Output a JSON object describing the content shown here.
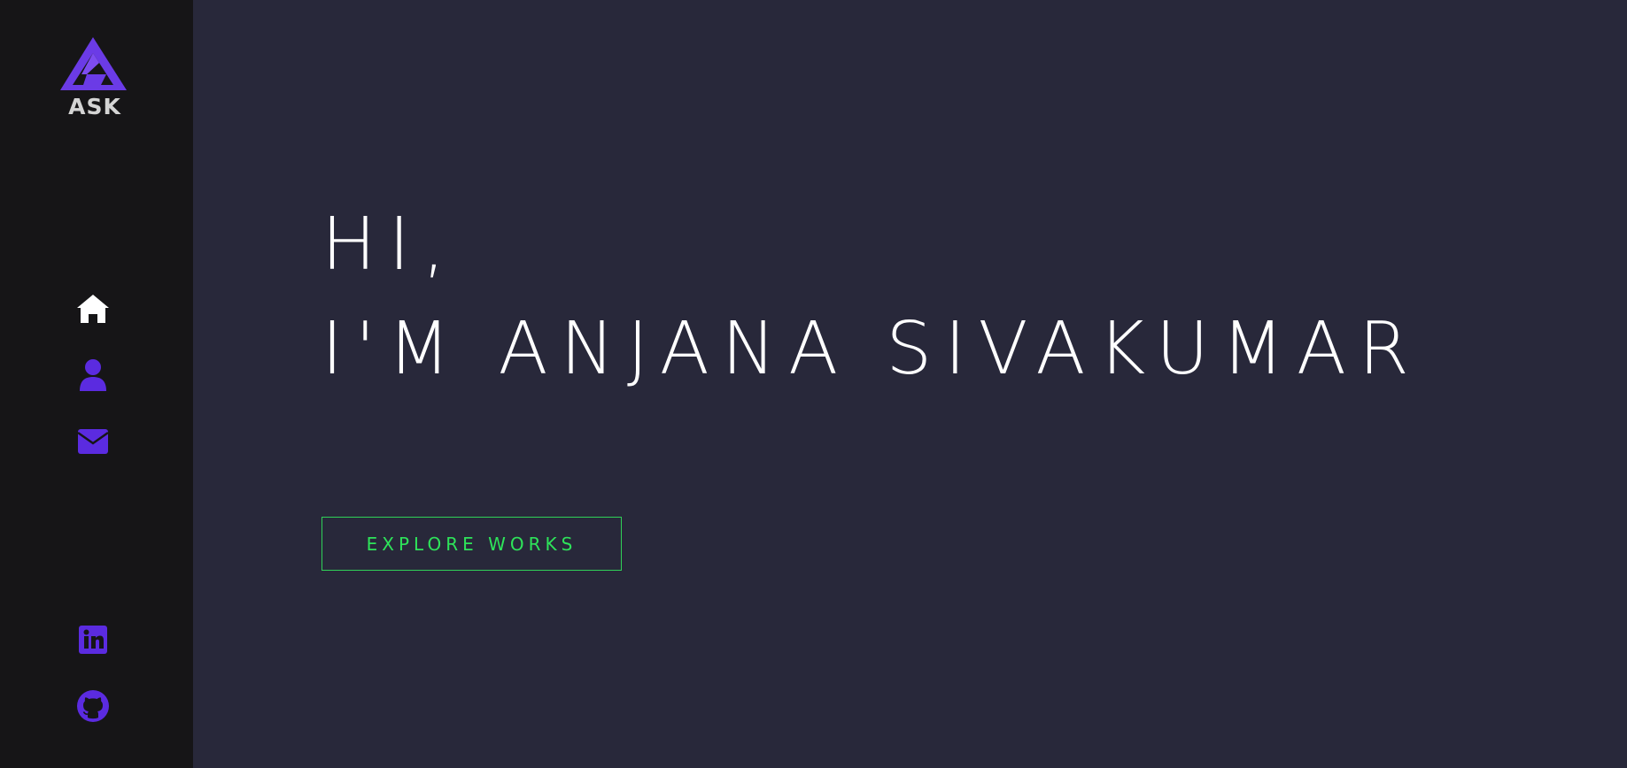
{
  "sidebar": {
    "logo": {
      "text": "ASK",
      "icon": "triangle-logo-icon"
    },
    "nav": [
      {
        "icon": "home-icon",
        "color": "#ffffff"
      },
      {
        "icon": "user-icon",
        "color": "#5b2be0"
      },
      {
        "icon": "envelope-icon",
        "color": "#5b2be0"
      }
    ],
    "social": [
      {
        "icon": "linkedin-icon",
        "color": "#5b2be0"
      },
      {
        "icon": "github-icon",
        "color": "#5b2be0"
      }
    ]
  },
  "hero": {
    "line1": "Hi,",
    "line2": "I'm Anjana Sivakumar",
    "button_label": "Explore Works"
  },
  "colors": {
    "sidebar_bg": "#161517",
    "main_bg": "#28283a",
    "accent_purple": "#5b2be0",
    "accent_green": "#2ee35a",
    "text": "#ffffff"
  }
}
